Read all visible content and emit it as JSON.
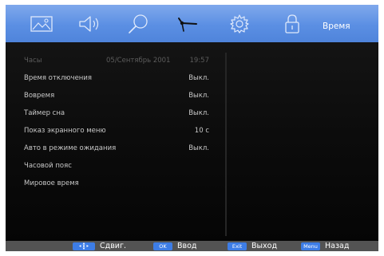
{
  "menu": {
    "tabs": [
      {
        "icon": "picture-icon"
      },
      {
        "icon": "speaker-icon"
      },
      {
        "icon": "search-icon"
      },
      {
        "icon": "clock-icon",
        "active": true
      },
      {
        "icon": "gear-icon"
      },
      {
        "icon": "lock-icon"
      }
    ],
    "title": "Время"
  },
  "settings": {
    "rows": [
      {
        "label": "Часы",
        "extra": "05/Сентябрь 2001",
        "value": "19:57",
        "enabled": false
      },
      {
        "label": "Время отключения",
        "value": "Выкл.",
        "enabled": true
      },
      {
        "label": "Вовремя",
        "value": "Выкл.",
        "enabled": true
      },
      {
        "label": "Таймер сна",
        "value": "Выкл.",
        "enabled": true
      },
      {
        "label": "Показ экранного меню",
        "value": "10 с",
        "enabled": true
      },
      {
        "label": "Авто в режиме ожидания",
        "value": "Выкл.",
        "enabled": true
      },
      {
        "label": "Часовой пояс",
        "value": "",
        "enabled": true
      },
      {
        "label": "Мировое время",
        "value": "",
        "enabled": true
      }
    ]
  },
  "footer": {
    "hints": [
      {
        "key": "",
        "key_icon": "dpad-icon",
        "label": "Сдвиг."
      },
      {
        "key": "OK",
        "label": "Ввод"
      },
      {
        "key": "Exit",
        "label": "Выход"
      },
      {
        "key": "Menu",
        "label": "Назад"
      }
    ]
  },
  "colors": {
    "topbar": "#5b8fe3",
    "key_badge": "#3d7de6",
    "text": "#c8c8c8",
    "text_disabled": "#5c5c5c",
    "footer": "#535353"
  }
}
